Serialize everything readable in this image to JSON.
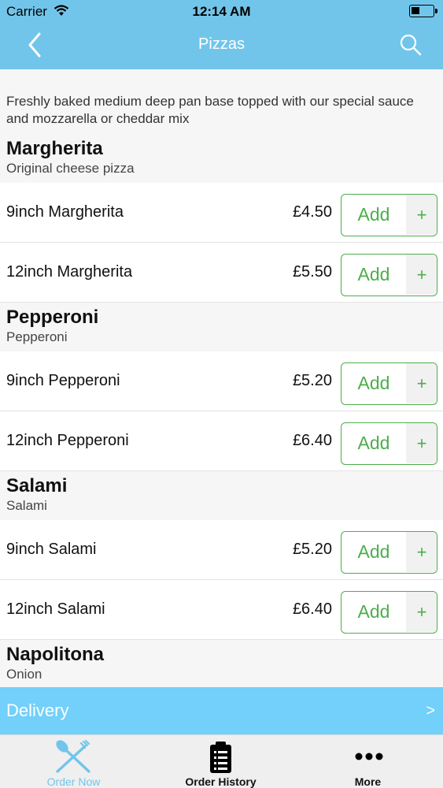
{
  "status_bar": {
    "carrier": "Carrier",
    "time": "12:14 AM"
  },
  "nav": {
    "title": "Pizzas"
  },
  "intro": "Freshly baked medium deep pan base topped with our special sauce and mozzarella or cheddar mix",
  "categories": [
    {
      "name": "Margherita",
      "description": "Original cheese pizza",
      "items": [
        {
          "name": "9inch Margherita",
          "price": "£4.50",
          "add_label": "Add",
          "plus": "+"
        },
        {
          "name": "12inch Margherita",
          "price": "£5.50",
          "add_label": "Add",
          "plus": "+"
        }
      ]
    },
    {
      "name": "Pepperoni",
      "description": "Pepperoni",
      "items": [
        {
          "name": "9inch Pepperoni",
          "price": "£5.20",
          "add_label": "Add",
          "plus": "+"
        },
        {
          "name": "12inch Pepperoni",
          "price": "£6.40",
          "add_label": "Add",
          "plus": "+"
        }
      ]
    },
    {
      "name": "Salami",
      "description": "Salami",
      "items": [
        {
          "name": "9inch Salami",
          "price": "£5.20",
          "add_label": "Add",
          "plus": "+"
        },
        {
          "name": "12inch Salami",
          "price": "£6.40",
          "add_label": "Add",
          "plus": "+"
        }
      ]
    },
    {
      "name": "Napolitona",
      "description": "Onion",
      "items": []
    }
  ],
  "delivery": {
    "label": "Delivery",
    "arrow": ">"
  },
  "tabs": [
    {
      "label": "Order Now",
      "icon": "fork-spoon-icon",
      "active": true
    },
    {
      "label": "Order History",
      "icon": "clipboard-list-icon",
      "active": false
    },
    {
      "label": "More",
      "icon": "more-dots-icon",
      "active": false
    }
  ],
  "colors": {
    "header": "#72c5ea",
    "delivery": "#72d0fa",
    "accent_green": "#4cae4c"
  }
}
